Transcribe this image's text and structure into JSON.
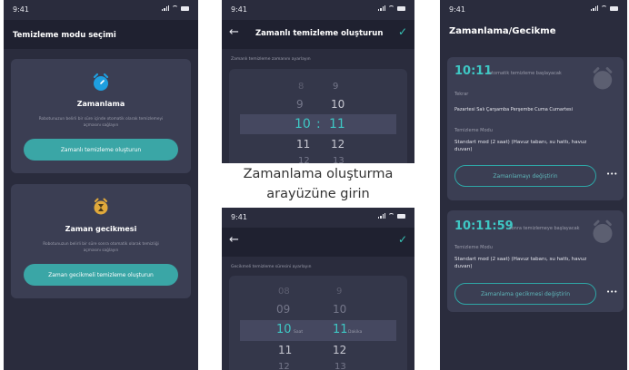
{
  "status_time": "9:41",
  "screen1": {
    "title": "Temizleme modu seçimi",
    "card1": {
      "title": "Zamanlama",
      "desc": "Robotunuzun belirli bir süre içinde otomatik olarak temizlemeyi açmasını sağlayın",
      "button": "Zamanlı temizleme oluşturun",
      "icon": "alarm-clock-icon"
    },
    "card2": {
      "title": "Zaman gecikmesi",
      "desc": "Robotunuzun belirli bir süre sonra otomatik olarak temizliği açmasını sağlayın",
      "button": "Zaman gecikmeli temizleme oluşturun",
      "icon": "hourglass-clock-icon"
    }
  },
  "screen2": {
    "title": "Zamanlı temizleme oluşturun",
    "picker_label": "Zamanlı temizleme zamanını ayarlayın",
    "hours": [
      "8",
      "9",
      "10",
      "11",
      "12"
    ],
    "minutes": [
      "9",
      "10",
      "11",
      "12",
      "13"
    ],
    "separator": ":"
  },
  "caption": {
    "line1": "Zamanlama oluşturma",
    "line2": "arayüzüne girin"
  },
  "screen3": {
    "picker_label": "Gecikmeli temizleme süresini ayarlayın",
    "hours": [
      "08",
      "09",
      "10",
      "11",
      "12"
    ],
    "minutes": [
      "9",
      "10",
      "11",
      "12",
      "13"
    ],
    "hour_unit": "Saat",
    "minute_unit": "Dakika"
  },
  "screen4": {
    "title": "Zamanlama/Gecikme",
    "card1": {
      "time": "10:11",
      "time_suffix": "otomatik temizleme başlayacak",
      "repeat_label": "Tekrar",
      "repeat_value": "Pazartesi Salı Çarşamba Perşembe Cuma Cumartesi",
      "mode_label": "Temizleme Modu",
      "mode_value": "Standart mod (2 saat) (Havuz tabanı, su hattı, havuz duvarı)",
      "button": "Zamanlamayı değiştirin"
    },
    "card2": {
      "time": "10:11:59",
      "time_suffix": "sonra temizlemeye başlayacak",
      "mode_label": "Temizleme Modu",
      "mode_value": "Standart mod (2 saat) (Havuz tabanı, su hattı, havuz duvarı)",
      "button": "Zamanlama gecikmesi değiştirin"
    },
    "more": "•••"
  },
  "colors": {
    "background": "#2a2c3d",
    "header": "#1f2130",
    "card": "#3b3e53",
    "accent": "#3aa6a6"
  }
}
